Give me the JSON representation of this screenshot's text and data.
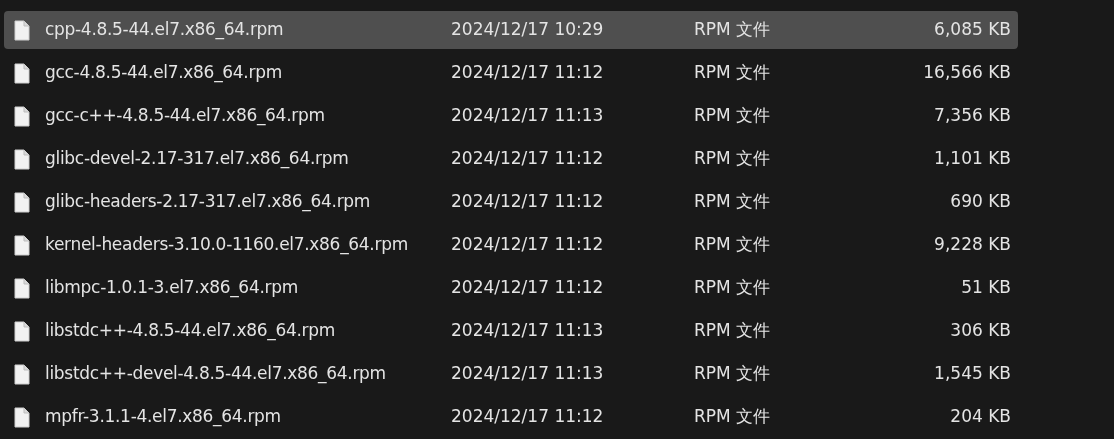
{
  "files": [
    {
      "name": "cpp-4.8.5-44.el7.x86_64.rpm",
      "modified": "2024/12/17 10:29",
      "type": "RPM 文件",
      "size": "6,085 KB",
      "selected": true
    },
    {
      "name": "gcc-4.8.5-44.el7.x86_64.rpm",
      "modified": "2024/12/17 11:12",
      "type": "RPM 文件",
      "size": "16,566 KB",
      "selected": false
    },
    {
      "name": "gcc-c++-4.8.5-44.el7.x86_64.rpm",
      "modified": "2024/12/17 11:13",
      "type": "RPM 文件",
      "size": "7,356 KB",
      "selected": false
    },
    {
      "name": "glibc-devel-2.17-317.el7.x86_64.rpm",
      "modified": "2024/12/17 11:12",
      "type": "RPM 文件",
      "size": "1,101 KB",
      "selected": false
    },
    {
      "name": "glibc-headers-2.17-317.el7.x86_64.rpm",
      "modified": "2024/12/17 11:12",
      "type": "RPM 文件",
      "size": "690 KB",
      "selected": false
    },
    {
      "name": "kernel-headers-3.10.0-1160.el7.x86_64.rpm",
      "modified": "2024/12/17 11:12",
      "type": "RPM 文件",
      "size": "9,228 KB",
      "selected": false
    },
    {
      "name": "libmpc-1.0.1-3.el7.x86_64.rpm",
      "modified": "2024/12/17 11:12",
      "type": "RPM 文件",
      "size": "51 KB",
      "selected": false
    },
    {
      "name": "libstdc++-4.8.5-44.el7.x86_64.rpm",
      "modified": "2024/12/17 11:13",
      "type": "RPM 文件",
      "size": "306 KB",
      "selected": false
    },
    {
      "name": "libstdc++-devel-4.8.5-44.el7.x86_64.rpm",
      "modified": "2024/12/17 11:13",
      "type": "RPM 文件",
      "size": "1,545 KB",
      "selected": false
    },
    {
      "name": "mpfr-3.1.1-4.el7.x86_64.rpm",
      "modified": "2024/12/17 11:12",
      "type": "RPM 文件",
      "size": "204 KB",
      "selected": false
    }
  ]
}
